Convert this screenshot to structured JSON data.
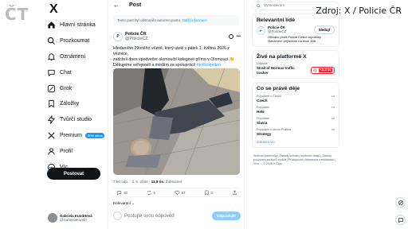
{
  "overlay": {
    "tv_logo": "ČT",
    "source_credit": "Zdroj: X / Policie ČR"
  },
  "sidebar": {
    "logo": "X",
    "items": [
      {
        "label": "Hlavní stránka",
        "icon": "home-icon"
      },
      {
        "label": "Prozkoumat",
        "icon": "search-icon"
      },
      {
        "label": "Oznámení",
        "icon": "bell-icon"
      },
      {
        "label": "Chat",
        "icon": "chat-icon"
      },
      {
        "label": "Grok",
        "icon": "grok-icon"
      },
      {
        "label": "Záložky",
        "icon": "bookmark-icon"
      },
      {
        "label": "Tvůrčí studio",
        "icon": "lightning-icon"
      },
      {
        "label": "Premium",
        "icon": "x-icon",
        "badge": "50% sleva"
      },
      {
        "label": "Profil",
        "icon": "person-icon"
      },
      {
        "label": "Víc",
        "icon": "more-icon"
      }
    ],
    "post_button": "Postovat",
    "account": {
      "name": "Gabriela Kundrtová",
      "handle": "@GabrielaKundrt"
    }
  },
  "main": {
    "header_title": "Post",
    "notice": {
      "text": "Tento post byl odstraněn autorem postu.",
      "link": "Další informace"
    },
    "tweet": {
      "author_name": "Policie ČR",
      "author_handle": "@PolicieCZ",
      "avatar_text": "P",
      "text_line1": "Hledaného 29letého vězně, který utekl v pátek 1. května 2026 z věznice,",
      "text_line2": "zadrželi dnes vpodvečer olomoučtí kolegové přímo v Olomouci 👏",
      "text_line3_plain": "Děkujeme veřejnosti a médiím za spolupráci! ",
      "text_line3_tags": "#policiejeden #policieolk",
      "meta_time": "7:50 odp. · 3. 5. 2026 · ",
      "meta_views": "11,8 tis.",
      "meta_views_label": " Zobrazení",
      "stats": {
        "replies": "30",
        "reposts": "5",
        "likes": "97",
        "bookmarks": "2"
      },
      "reply_sort": "Relevantní ⌄",
      "reply_placeholder": "Postujte svou odpověď",
      "reply_button": "Odpovědět"
    }
  },
  "right": {
    "search_placeholder": "Vyhledávání",
    "relevant": {
      "title": "Relevantní lidé",
      "name": "Policie ČR",
      "handle": "@PolicieCZ",
      "follow_label": "Sledují",
      "bio": "Oficiální profil Policie České republiky. Oznámení přijímáme na lince 158."
    },
    "live": {
      "title": "Živě na platformě X",
      "label": "Události",
      "stream_title": "Strait of Hormuz traffic tracker",
      "viewers": "+11,3 tis."
    },
    "trends": {
      "title": "Co se právě děje",
      "items": [
        {
          "category": "Populární v Česko",
          "name": "Czech"
        },
        {
          "category": "Populární",
          "name": "Hele"
        },
        {
          "category": "Populární",
          "name": "Slavia"
        },
        {
          "category": "Populární v oboru Politika",
          "name": "Strategy"
        }
      ],
      "show_more": "Zobrazit víc"
    },
    "footer": "Smluvní podmínky | Zásady ochrany osobních údajů | Zásady používání souborů cookie | Přístupnost | Informace o reklamách | Více ... © 2026 X Corp."
  },
  "colors": {
    "accent": "#1d9bf0",
    "text": "#0f1419",
    "muted": "#536471",
    "live_red": "#f4212e"
  }
}
